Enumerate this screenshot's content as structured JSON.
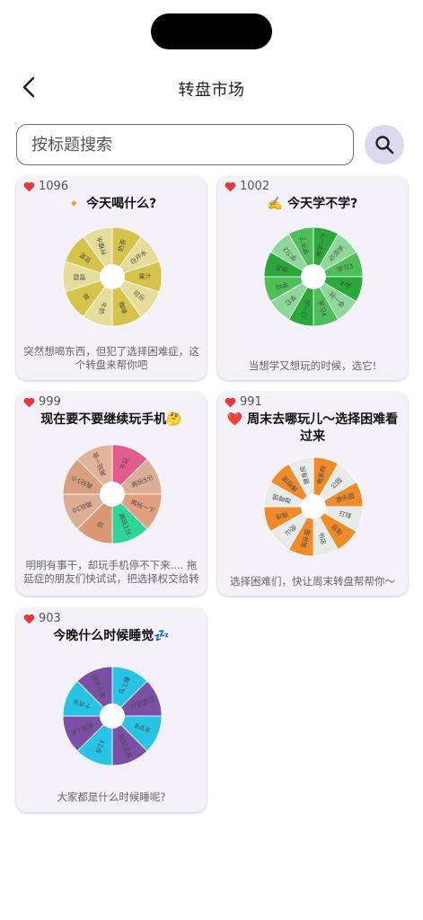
{
  "header": {
    "title": "转盘市场",
    "back_icon": "chevron-left-icon"
  },
  "search": {
    "placeholder": "按标题搜索",
    "value": "",
    "icon": "search-icon",
    "button_color": "#dcd8f0"
  },
  "like_icon": "heart-icon",
  "like_color": "#e5383b",
  "cards": [
    {
      "likes": "1096",
      "title": "🔸 今天喝什么?",
      "description": "突然想喝东西，但犯了选择困难症，这个转盘来帮你吧",
      "wheel": {
        "segments": [
          "奶茶",
          "白开水",
          "果汁",
          "可乐",
          "咖啡",
          "牛奶",
          "茶",
          "雪碧",
          "豆浆",
          "柠檬水"
        ],
        "colors": [
          "#d6c44a",
          "#e6dd9a"
        ]
      }
    },
    {
      "likes": "1002",
      "title": "✍️ 今天学不学?",
      "description": "当想学又想玩的时候，选它!",
      "wheel": {
        "segments": [
          "再学一下",
          "必须学",
          "学习3",
          "不学",
          "玩一会",
          "学习4",
          "学一口",
          "学它",
          "学吗",
          "休息",
          "学习2",
          "学不了"
        ],
        "colors": [
          "#2aa83a",
          "#8ed99a",
          "#4cbf58"
        ]
      }
    },
    {
      "likes": "999",
      "title": "现在要不要继续玩手机🤔",
      "description": "明明有事干，却玩手机停不下来.... 拖延症的朋友们快试试，把选择权交给转盘",
      "wheel": {
        "segments": [
          "不玩",
          "再玩5分钟",
          "再玩一下",
          "再玩1分钟",
          "玩",
          "再玩10分钟",
          "再玩1小时",
          "再玩一会"
        ],
        "colors": [
          "#e25c8c",
          "#dcae96",
          "#e0a080",
          "#2ed39a",
          "#d99775",
          "#dcae96",
          "#d9a07f",
          "#e2b49a"
        ]
      }
    },
    {
      "likes": "991",
      "title": "❤️ 周末去哪玩儿～选择困难看过来",
      "description": "选择困难们，快让周末转盘帮帮你～",
      "wheel": {
        "segments": [
          "电影院",
          "公园",
          "游乐园",
          "打球",
          "逛街",
          "书店",
          "图书馆",
          "爬山",
          "商场",
          "咖啡馆",
          "博物馆",
          "健身房"
        ],
        "colors": [
          "#f08b2a",
          "#e7ece9"
        ]
      }
    },
    {
      "likes": "903",
      "title": "今晚什么时候睡觉💤",
      "description": "大家都是什么时候睡呢?",
      "wheel": {
        "segments": [
          "马上睡",
          "打把游戏",
          "8点半",
          "熬到凌晨",
          "12点",
          "刷到1点",
          "十点半",
          "看个电影"
        ],
        "colors": [
          "#27c4e6",
          "#7b4fa6"
        ]
      }
    }
  ]
}
